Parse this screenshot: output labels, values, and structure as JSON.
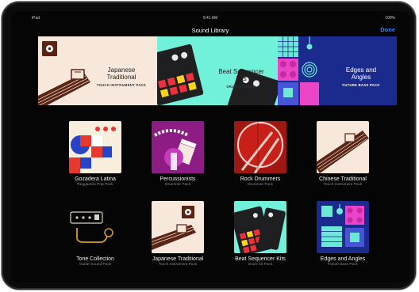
{
  "status": {
    "left": "iPad",
    "time": "9:41 AM",
    "battery": "100%"
  },
  "nav": {
    "title": "Sound Library",
    "done": "Done"
  },
  "banners": [
    {
      "title_line1": "Japanese",
      "title_line2": "Traditional",
      "subtitle": "TOUCH INSTRUMENT PACK"
    },
    {
      "title_line1": "Beat Sequencer",
      "title_line2": "Kits",
      "subtitle": "DRUM KIT PACK"
    },
    {
      "title_line1": "Edges and",
      "title_line2": "Angles",
      "subtitle": "FUTURE BASS PACK"
    }
  ],
  "packs": [
    {
      "title": "Gozadera Latina",
      "subtitle": "Reggaeton Pop Pack"
    },
    {
      "title": "Percussionists",
      "subtitle": "Drummer Pack"
    },
    {
      "title": "Rock Drummers",
      "subtitle": "Drummer Pack"
    },
    {
      "title": "Chinese Traditional",
      "subtitle": "Touch Instrument Pack"
    },
    {
      "title": "Tone Collection",
      "subtitle": "Guitar Sound Pack"
    },
    {
      "title": "Japanese Traditional",
      "subtitle": "Touch Instrument Pack"
    },
    {
      "title": "Beat Sequencer Kits",
      "subtitle": "Drum Kit Pack"
    },
    {
      "title": "Edges and Angles",
      "subtitle": "Future Bass Pack"
    }
  ]
}
